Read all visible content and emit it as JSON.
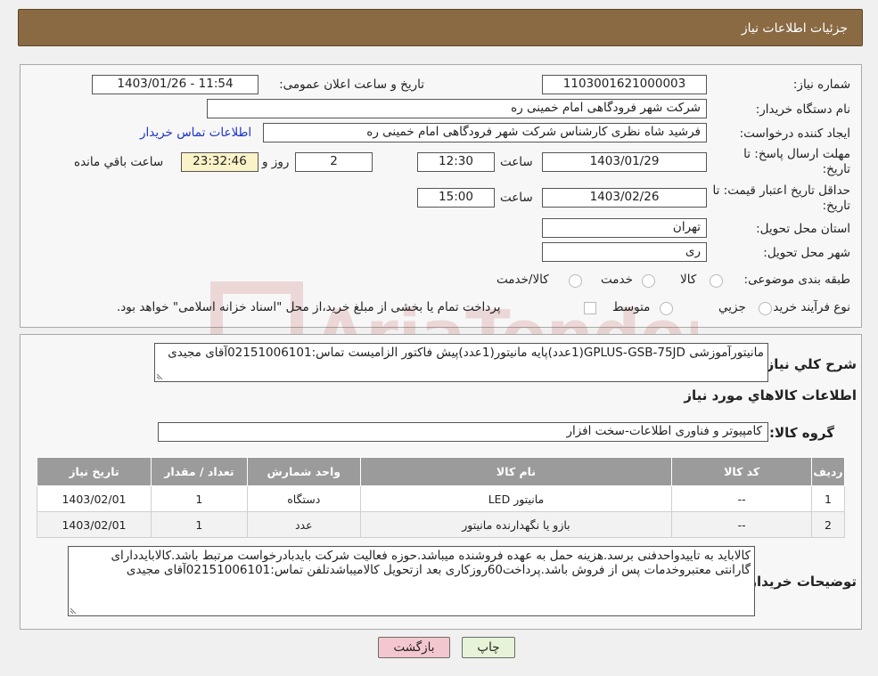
{
  "header": {
    "title": "جزئیات اطلاعات نیاز"
  },
  "form": {
    "need_number_label": "شماره نیاز:",
    "need_number": "1103001621000003",
    "announce_label": "تاریخ و ساعت اعلان عمومی:",
    "announce_value": "1403/01/26 - 11:54",
    "buyer_org_label": "نام دستگاه خریدار:",
    "buyer_org": "شرکت شهر فرودگاهی امام خمینی  ره",
    "creator_label": "ایجاد کننده درخواست:",
    "creator": "فرشید شاه نظری کارشناس شرکت شهر فرودگاهی امام خمینی  ره",
    "contact_link": "اطلاعات تماس خریدار",
    "deadline_label_line1": "مهلت ارسال پاسخ: تا",
    "deadline_label_line2": "تاریخ:",
    "deadline_date": "1403/01/29",
    "time_label": "ساعت",
    "deadline_time": "12:30",
    "days_value": "2",
    "days_label": "روز و",
    "remaining_time": "23:32:46",
    "remaining_label": "ساعت باقي مانده",
    "validity_label_line1": "حداقل تاریخ اعتبار قیمت: تا",
    "validity_label_line2": "تاریخ:",
    "validity_date": "1403/02/26",
    "validity_time": "15:00",
    "province_label": "استان محل تحویل:",
    "province": "تهران",
    "city_label": "شهر محل تحویل:",
    "city": "ری",
    "category_label": "طبقه بندی موضوعی:",
    "category_options": [
      "کالا",
      "خدمت",
      "کالا/خدمت"
    ],
    "process_label": "نوع فرآیند خرید :",
    "process_options": [
      "جزیي",
      "متوسط"
    ],
    "payment_note": "پرداخت تمام یا بخشی از مبلغ خرید،از محل \"اسناد خزانه اسلامی\" خواهد بود."
  },
  "watermark": {
    "text": "AriaTender.neT"
  },
  "details": {
    "description_label": "شرح کلي نياز:",
    "description": "مانیتورآموزشی GPLUS-GSB-75JD(1عدد)پایه مانیتور(1عدد)پیش فاکتور الزامیست تماس:02151006101آقای مجیدی",
    "items_heading": "اطلاعات کالاهاي مورد نياز",
    "group_label": "گروه کالا:",
    "group_value": "کامپیوتر و فناوری اطلاعات-سخت افزار",
    "table": {
      "headers": [
        "ردیف",
        "کد کالا",
        "نام کالا",
        "واحد شمارش",
        "تعداد / مقدار",
        "تاریخ نیاز"
      ],
      "rows": [
        [
          "1",
          "--",
          "مانیتور LED",
          "دستگاه",
          "1",
          "1403/02/01"
        ],
        [
          "2",
          "--",
          "بازو یا نگهدارنده مانیتور",
          "عدد",
          "1",
          "1403/02/01"
        ]
      ]
    },
    "buyer_notes_label": "توضیحات خریدار:",
    "buyer_notes": "کالاباید به تاییدواحدفنی برسد.هزینه حمل به عهده فروشنده میباشد.حوزه فعالیت شرکت بایدبادرخواست مرتبط باشد.کالابایددارای گارانتی معتبروخدمات پس از فروش باشد.پرداخت60روزکاری بعد ازتحویل کالامیباشدتلفن تماس:02151006101آقای مجیدی"
  },
  "buttons": {
    "print": "چاپ",
    "back": "بازگشت"
  },
  "colors": {
    "header_bg": "#8a6a43",
    "link": "#1a33cc",
    "back_btn": "#f4c7cf"
  }
}
